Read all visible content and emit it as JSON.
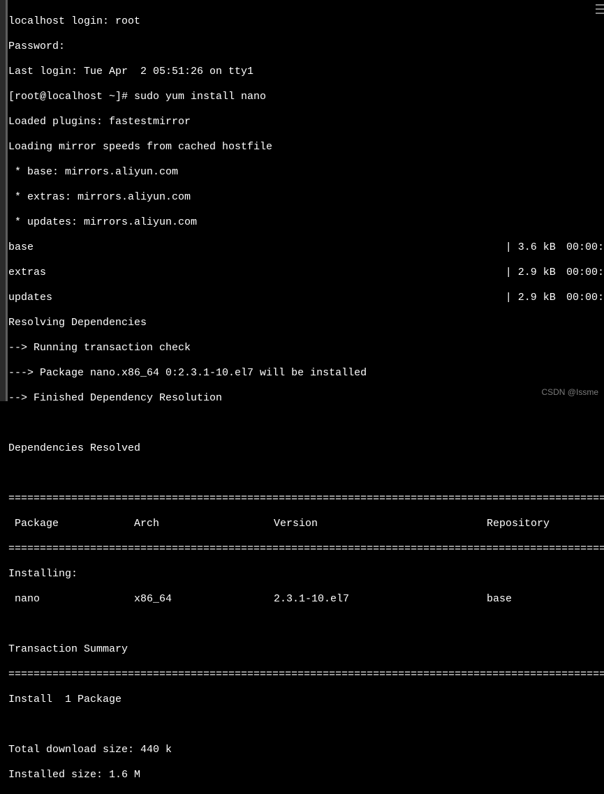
{
  "login": {
    "prompt": "localhost login: ",
    "user": "root",
    "password_label": "Password:",
    "last_login": "Last login: Tue Apr  2 05:51:26 on tty1"
  },
  "shell": {
    "prompt": "[root@localhost ~]# ",
    "command": "sudo yum install nano"
  },
  "yum": {
    "plugins": "Loaded plugins: fastestmirror",
    "loading": "Loading mirror speeds from cached hostfile",
    "mirrors": [
      " * base: mirrors.aliyun.com",
      " * extras: mirrors.aliyun.com",
      " * updates: mirrors.aliyun.com"
    ],
    "repos": [
      {
        "name": "base",
        "sep": "| ",
        "size": "3.6 kB",
        "time": "00:00:"
      },
      {
        "name": "extras",
        "sep": "| ",
        "size": "2.9 kB",
        "time": "00:00:"
      },
      {
        "name": "updates",
        "sep": "| ",
        "size": "2.9 kB",
        "time": "00:00:"
      }
    ],
    "resolving": "Resolving Dependencies",
    "trans_check": "--> Running transaction check",
    "pkg_line": "---> Package nano.x86_64 0:2.3.1-10.el7 will be installed",
    "finished": "--> Finished Dependency Resolution",
    "deps_resolved": "Dependencies Resolved"
  },
  "table": {
    "divider": "=========================================================================================================",
    "headers": {
      "pkg": " Package",
      "arch": "Arch",
      "ver": "Version",
      "repo": "Repository"
    },
    "installing_label": "Installing:",
    "row": {
      "pkg": " nano",
      "arch": "x86_64",
      "ver": "2.3.1-10.el7",
      "repo": "base"
    }
  },
  "summary": {
    "title": "Transaction Summary",
    "install": "Install  1 Package",
    "download": "Total download size: 440 k",
    "installed": "Installed size: 1.6 M"
  },
  "watermark": "CSDN @Issme"
}
